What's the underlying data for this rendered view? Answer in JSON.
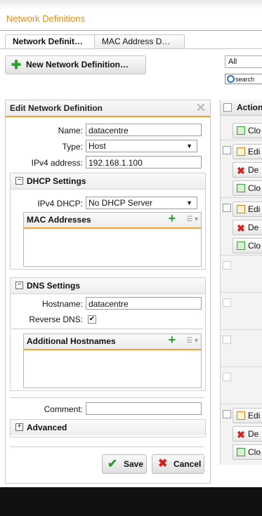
{
  "window": {
    "title": "Network Definitions"
  },
  "tabs": [
    {
      "label": "Network Definit…"
    },
    {
      "label": "MAC Address D…"
    }
  ],
  "toolbar": {
    "new_label": "New Network Definition…"
  },
  "filter": {
    "selected": "All",
    "search_label": "search"
  },
  "grid": {
    "header": "Action",
    "copy_label": "Clo",
    "edit_label": "Edi",
    "delete_label": "De"
  },
  "panel": {
    "title": "Edit Network Definition",
    "name_label": "Name:",
    "name_value": "datacentre",
    "type_label": "Type:",
    "type_value": "Host",
    "ipv4_label": "IPv4 address:",
    "ipv4_value": "192.168.1.100",
    "dhcp": {
      "title": "DHCP Settings",
      "ipv4dhcp_label": "IPv4 DHCP:",
      "ipv4dhcp_value": "No DHCP Server",
      "mac_title": "MAC Addresses"
    },
    "dns": {
      "title": "DNS Settings",
      "hostname_label": "Hostname:",
      "hostname_value": "datacentre",
      "reverse_label": "Reverse DNS:",
      "addl_title": "Additional Hostnames"
    },
    "comment_label": "Comment:",
    "advanced_title": "Advanced",
    "save_label": "Save",
    "cancel_label": "Cancel"
  },
  "colors": {
    "accent": "#f0a030",
    "title": "#e28a1d",
    "add_green": "#2c9c2c",
    "cancel_red": "#d42020"
  }
}
